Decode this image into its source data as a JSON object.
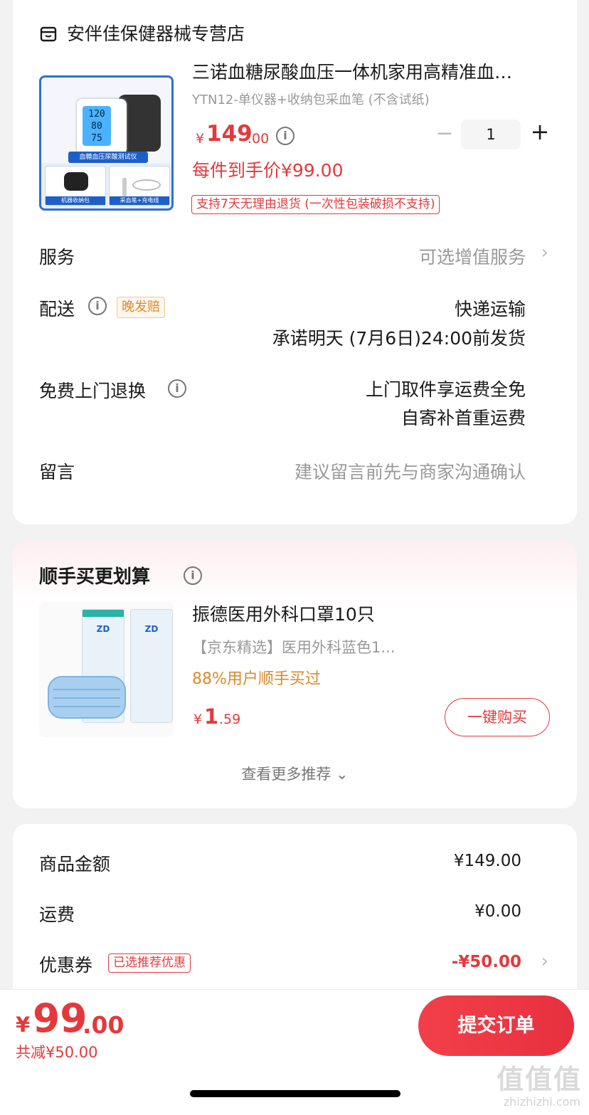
{
  "store": {
    "name": "安伴佳保健器械专营店",
    "icon": "store-icon"
  },
  "product": {
    "title": "三诺血糖尿酸血压一体机家用高精准血…",
    "spec": "YTN12-单仪器+收纳包采血笔 (不含试纸)",
    "image_screen": [
      "120",
      "80",
      "75"
    ],
    "image_banner": "血糖血压尿酸测试仪",
    "image_box1": "机器收纳包",
    "image_box2": "采血笔+充电线",
    "price_symbol": "¥",
    "price_int": "149",
    "price_dec": ".00",
    "quantity": "1",
    "minus": "−",
    "plus": "+",
    "unit_price": "每件到手价¥99.00",
    "return_tag": "支持7天无理由退货 (一次性包装破损不支持)"
  },
  "rows": {
    "service": {
      "label": "服务",
      "value": "可选增值服务"
    },
    "delivery": {
      "label": "配送",
      "tag": "晚发赔",
      "value1": "快递运输",
      "value2": "承诺明天 (7月6日)24:00前发货"
    },
    "return": {
      "label": "免费上门退换",
      "value1": "上门取件享运费全免",
      "value2": "自寄补首重运费"
    },
    "message": {
      "label": "留言",
      "value": "建议留言前先与商家沟通确认"
    }
  },
  "addon": {
    "title": "顺手买更划算",
    "name": "振德医用外科口罩10只",
    "desc": "【京东精选】医用外科蓝色1...",
    "users": "88%用户顺手买过",
    "price_symbol": "¥",
    "price_int": "1",
    "price_dec": ".59",
    "buy_label": "一键购买",
    "more_label": "查看更多推荐 ⌄",
    "pack_label": "ZD"
  },
  "summary": {
    "goods": {
      "label": "商品金额",
      "value": "¥149.00"
    },
    "shipping": {
      "label": "运费",
      "value": "¥0.00"
    },
    "coupon": {
      "label": "优惠券",
      "tag": "已选推荐优惠",
      "value": "-¥50.00"
    }
  },
  "bottom": {
    "total_symbol": "¥",
    "total_int": "99",
    "total_dec": ".00",
    "saved": "共减¥50.00",
    "submit_label": "提交订单",
    "watermark": "值值值",
    "watermark_url": "zhizhizhi.com"
  },
  "colors": {
    "accent": "#e4393c",
    "orange": "#d98a2b",
    "brand_blue": "#1d5fc9"
  }
}
